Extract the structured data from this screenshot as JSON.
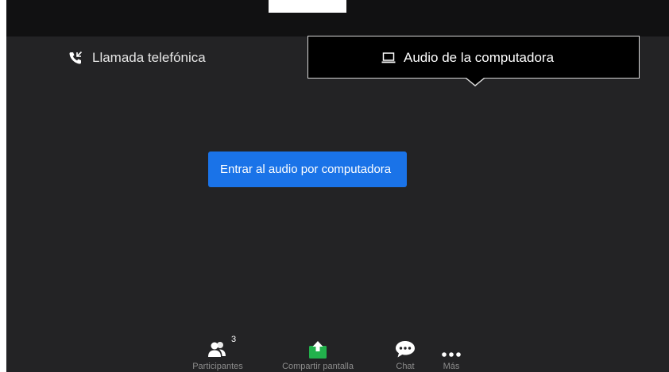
{
  "tabs": {
    "phone": {
      "label": "Llamada telefónica",
      "icon": "phone-icon"
    },
    "computer": {
      "label": "Audio de la computadora",
      "icon": "laptop-icon"
    }
  },
  "main": {
    "join_button_label": "Entrar al audio por computadora"
  },
  "toolbar": {
    "participants": {
      "label": "Participantes",
      "count": "3",
      "icon": "participants-icon"
    },
    "share": {
      "label": "Compartir pantalla",
      "icon": "share-screen-icon"
    },
    "chat": {
      "label": "Chat",
      "icon": "chat-icon"
    },
    "more": {
      "label": "Más",
      "icon": "more-icon"
    }
  },
  "colors": {
    "background": "#232325",
    "topbar": "#111112",
    "primary_button": "#1a73e8",
    "share_icon": "#22b14c"
  }
}
